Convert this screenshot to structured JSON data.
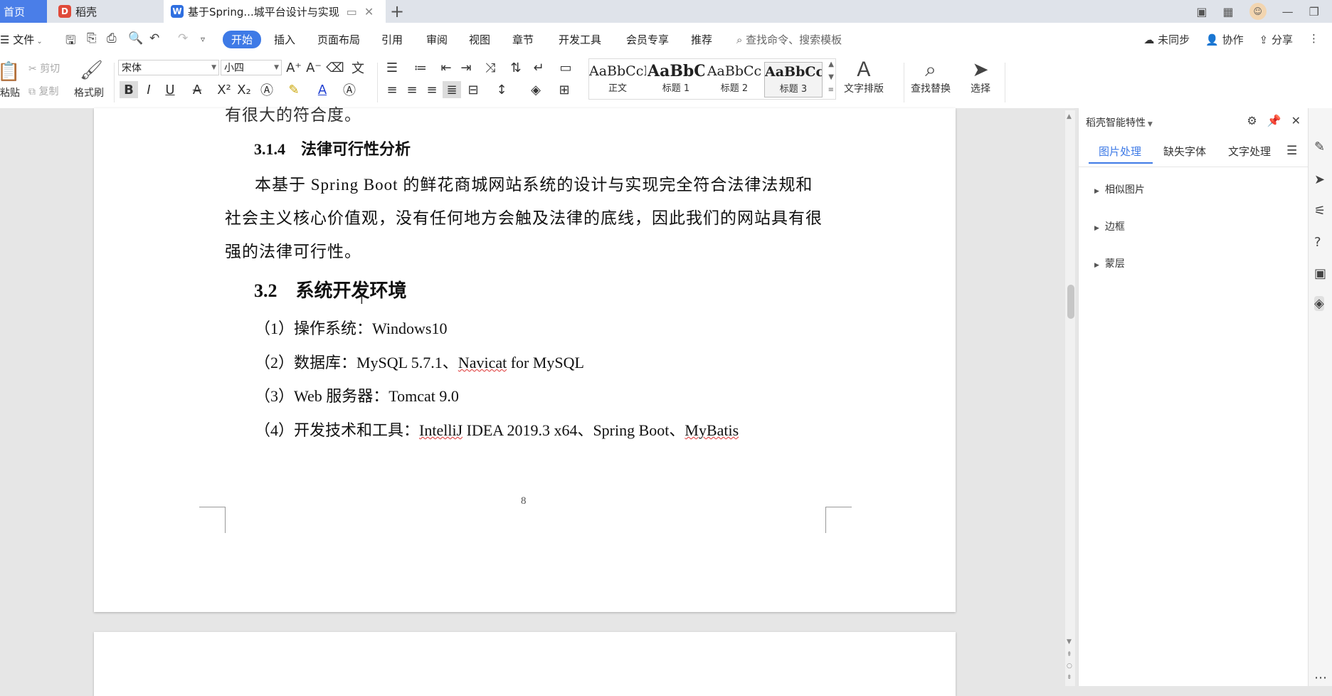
{
  "tabs": {
    "home": "首页",
    "daoke": "稻壳",
    "doc": "基于Spring...城平台设计与实现"
  },
  "menu": {
    "file": "文件",
    "items": [
      "开始",
      "插入",
      "页面布局",
      "引用",
      "审阅",
      "视图",
      "章节",
      "开发工具",
      "会员专享",
      "推荐"
    ],
    "search_placeholder": "查找命令、搜索模板",
    "unsynced": "未同步",
    "collab": "协作",
    "share": "分享"
  },
  "ribbon": {
    "paste": "粘贴",
    "cut": "剪切",
    "copy": "复制",
    "format_painter": "格式刷",
    "font_name": "宋体",
    "font_size": "小四",
    "styles": [
      {
        "sample": "AaBbCcI",
        "label": "正文"
      },
      {
        "sample": "AaBbC",
        "label": "标题 1"
      },
      {
        "sample": "AaBbCc",
        "label": "标题 2"
      },
      {
        "sample": "AaBbCcl",
        "label": "标题 3"
      }
    ],
    "text_layout": "文字排版",
    "find_replace": "查找替换",
    "select": "选择"
  },
  "document": {
    "top_fragment": "有很大的符合度。",
    "heading_314": "3.1.4　法律可行性分析",
    "para_line1": "本基于 Spring Boot 的鲜花商城网站系统的设计与实现完全符合法律法规和",
    "para_line2": "社会主义核心价值观，没有任何地方会触及法律的底线，因此我们的网站具有很",
    "para_line3": "强的法律可行性。",
    "heading_32": "3.2　系统开发环境",
    "list1_prefix": "（1）操作系统：Windows10",
    "list2_prefix": "（2）数据库：MySQL 5.7.1、",
    "list2_navicat": "Navicat",
    "list2_suffix": " for MySQL",
    "list3": "（3）Web 服务器：Tomcat 9.0",
    "list4_prefix": "（4）开发技术和工具：",
    "list4_intellij": "IntelliJ",
    "list4_mid": " IDEA 2019.3 x64、Spring Boot、",
    "list4_mybatis": "MyBatis",
    "page_number": "8"
  },
  "panel": {
    "title": "稻壳智能特性",
    "tabs": [
      "图片处理",
      "缺失字体",
      "文字处理"
    ],
    "items": [
      "相似图片",
      "边框",
      "蒙层"
    ]
  },
  "colors": {
    "accent": "#3e7ae6",
    "spell_underline": "#d33"
  },
  "icons": [
    "gear-icon",
    "pin-icon",
    "close-icon",
    "menu-icon",
    "search-icon",
    "undo-icon",
    "redo-icon"
  ]
}
